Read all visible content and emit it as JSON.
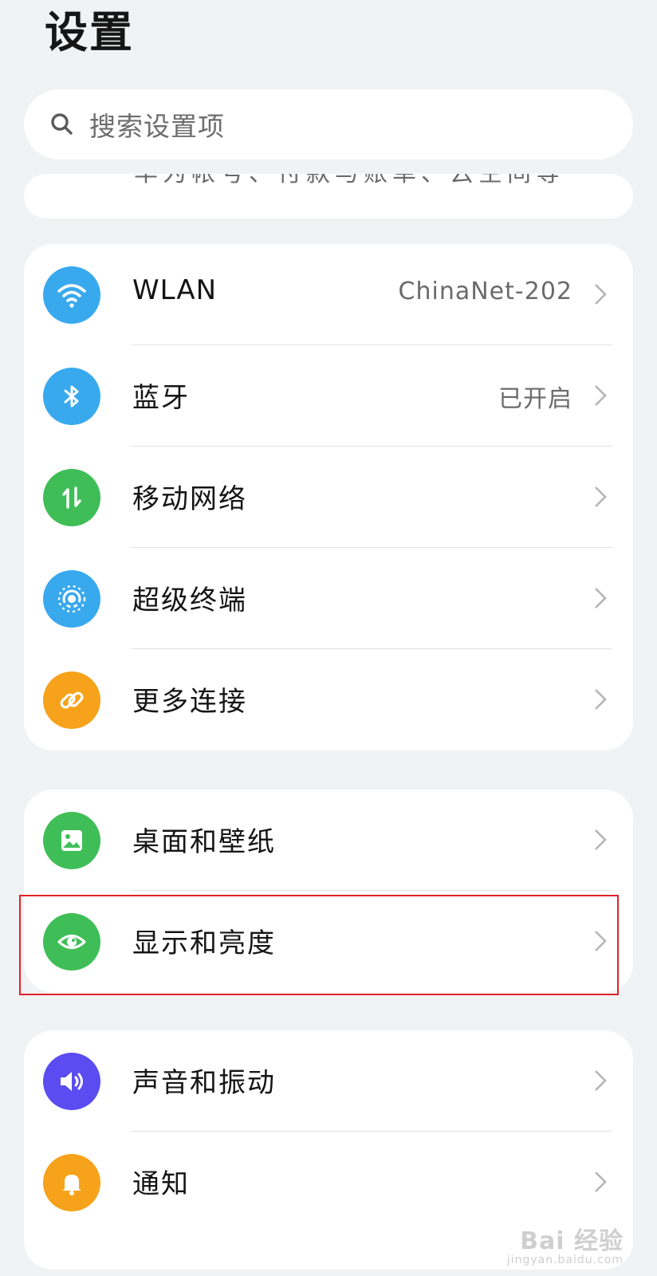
{
  "header": {
    "title": "设置"
  },
  "search": {
    "placeholder": "搜索设置项"
  },
  "partial_text": "华为帐号、付款与账单、云空间等",
  "groups": [
    {
      "items": [
        {
          "label": "WLAN",
          "value": "ChinaNet-202",
          "icon": "wifi-icon",
          "color": "#39a9ee"
        },
        {
          "label": "蓝牙",
          "value": "已开启",
          "icon": "bluetooth-icon",
          "color": "#39a9ee"
        },
        {
          "label": "移动网络",
          "value": "",
          "icon": "mobile-data-icon",
          "color": "#3fbe57"
        },
        {
          "label": "超级终端",
          "value": "",
          "icon": "super-device-icon",
          "color": "#39a9ee"
        },
        {
          "label": "更多连接",
          "value": "",
          "icon": "link-icon",
          "color": "#f6a21a"
        }
      ]
    },
    {
      "items": [
        {
          "label": "桌面和壁纸",
          "value": "",
          "icon": "wallpaper-icon",
          "color": "#3fbe57"
        },
        {
          "label": "显示和亮度",
          "value": "",
          "icon": "eye-icon",
          "color": "#3fbe57"
        }
      ]
    },
    {
      "items": [
        {
          "label": "声音和振动",
          "value": "",
          "icon": "sound-icon",
          "color": "#5a4cf0"
        },
        {
          "label": "通知",
          "value": "",
          "icon": "bell-icon",
          "color": "#f6a21a"
        }
      ]
    }
  ],
  "watermark": {
    "line1": "Bai 经验",
    "line2": "jingyan.baidu.com"
  }
}
